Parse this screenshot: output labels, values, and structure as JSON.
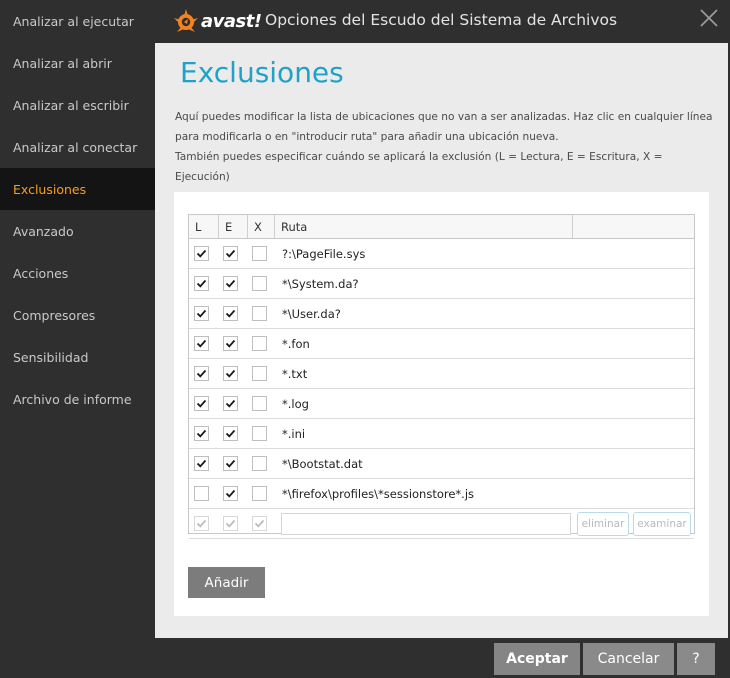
{
  "sidebar": {
    "items": [
      {
        "label": "Analizar al ejecutar",
        "active": false
      },
      {
        "label": "Analizar al abrir",
        "active": false
      },
      {
        "label": "Analizar al escribir",
        "active": false
      },
      {
        "label": "Analizar al conectar",
        "active": false
      },
      {
        "label": "Exclusiones",
        "active": true
      },
      {
        "label": "Avanzado",
        "active": false
      },
      {
        "label": "Acciones",
        "active": false
      },
      {
        "label": "Compresores",
        "active": false
      },
      {
        "label": "Sensibilidad",
        "active": false
      },
      {
        "label": "Archivo de informe",
        "active": false
      }
    ]
  },
  "titlebar": {
    "logo_text": "avast!",
    "title": "Opciones del Escudo del Sistema de Archivos",
    "close_icon": "close-icon"
  },
  "main": {
    "page_title": "Exclusiones",
    "description_line1": "Aquí puedes modificar la lista de ubicaciones que no van a ser analizadas. Haz clic en cualquier línea",
    "description_line2": "para modificarla o en \"introducir ruta\" para añadir una ubicación nueva.",
    "description_line3": "También puedes especificar cuándo se aplicará la exclusión (L = Lectura, E = Escritura, X = Ejecución)"
  },
  "table": {
    "headers": {
      "l": "L",
      "e": "E",
      "x": "X",
      "path": "Ruta"
    },
    "rows": [
      {
        "l": true,
        "e": true,
        "x": false,
        "path": "?:\\PageFile.sys"
      },
      {
        "l": true,
        "e": true,
        "x": false,
        "path": "*\\System.da?"
      },
      {
        "l": true,
        "e": true,
        "x": false,
        "path": "*\\User.da?"
      },
      {
        "l": true,
        "e": true,
        "x": false,
        "path": "*.fon"
      },
      {
        "l": true,
        "e": true,
        "x": false,
        "path": "*.txt"
      },
      {
        "l": true,
        "e": true,
        "x": false,
        "path": "*.log"
      },
      {
        "l": true,
        "e": true,
        "x": false,
        "path": "*.ini"
      },
      {
        "l": true,
        "e": true,
        "x": false,
        "path": "*\\Bootstat.dat"
      },
      {
        "l": false,
        "e": true,
        "x": false,
        "path": "*\\firefox\\profiles\\*sessionstore*.js"
      }
    ],
    "new_row": {
      "path_value": "",
      "remove_label": "eliminar",
      "browse_label": "examinar"
    }
  },
  "buttons": {
    "add_label": "Añadir",
    "accept_label": "Aceptar",
    "cancel_label": "Cancelar",
    "help_label": "?"
  },
  "colors": {
    "accent_orange": "#f59f1e",
    "title_blue": "#1fa2c7",
    "sidebar_bg": "#2f2f2f",
    "content_bg": "#ebebeb"
  }
}
